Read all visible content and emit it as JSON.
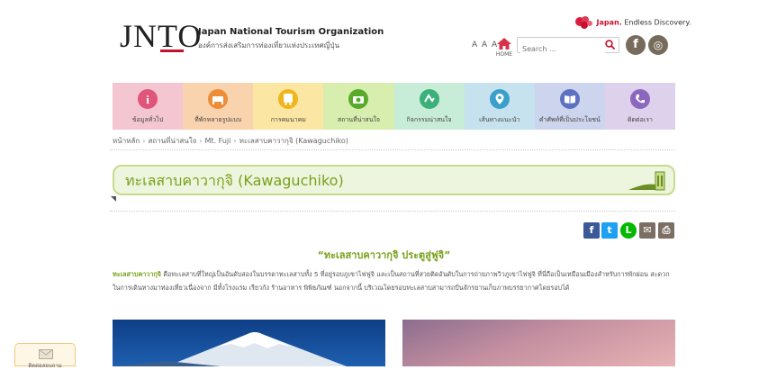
{
  "header": {
    "logo": "JNTO",
    "org_name_en": "Japan National Tourism Organization",
    "org_name_th": "องค์การส่งเสริมการท่องเที่ยวแห่งประเทศญี่ปุ่น",
    "tagline_brand": "Japan.",
    "tagline_rest": " Endless Discovery.",
    "font_size_control": "A A A",
    "home_label": "HOME",
    "search_placeholder": "Search ...",
    "social": [
      {
        "icon": "facebook-icon",
        "glyph": "f"
      },
      {
        "icon": "instagram-icon",
        "glyph": "◎"
      }
    ]
  },
  "nav": [
    {
      "label": "ข้อมูลทั่วไป",
      "icon": "info-icon",
      "bg": "#f4c6d2",
      "icon_color": "#e0557a"
    },
    {
      "label": "ที่พักหลายรูปแบบ",
      "icon": "bed-icon",
      "bg": "#f9d3ae",
      "icon_color": "#ee8d37"
    },
    {
      "label": "การคมนาคม",
      "icon": "bus-icon",
      "bg": "#fbe7a3",
      "icon_color": "#f0b51b"
    },
    {
      "label": "สถานที่น่าสนใจ",
      "icon": "camera-icon",
      "bg": "#d7eeae",
      "icon_color": "#58ab29"
    },
    {
      "label": "กิจกรรมน่าสนใจ",
      "icon": "activity-icon",
      "bg": "#c7ecd8",
      "icon_color": "#3bb07a"
    },
    {
      "label": "เส้นทางแนะนำ",
      "icon": "map-pin-icon",
      "bg": "#c5e2ee",
      "icon_color": "#3a9fca"
    },
    {
      "label": "คำศัพท์ที่เป็นประโยชน์",
      "icon": "book-icon",
      "bg": "#cdd5ee",
      "icon_color": "#5c72c0"
    },
    {
      "label": "ติดต่อเรา",
      "icon": "phone-icon",
      "bg": "#ddd1ec",
      "icon_color": "#8b67bf"
    }
  ],
  "breadcrumb": [
    "หน้าหลัก",
    "สถานที่น่าสนใจ",
    "Mt. Fuji",
    "ทะเลสาบคาวากุจิ (Kawaguchiko)"
  ],
  "page_title": "ทะเลสาบคาวากุจิ (Kawaguchiko)",
  "share_buttons": [
    {
      "icon": "facebook-share-icon",
      "glyph": "f",
      "color": "#3b5998"
    },
    {
      "icon": "twitter-share-icon",
      "glyph": "t",
      "color": "#1da1f2"
    },
    {
      "icon": "line-share-icon",
      "glyph": "L",
      "color": "#00b900"
    },
    {
      "icon": "email-share-icon",
      "glyph": "✉",
      "color": "#7b6f63"
    },
    {
      "icon": "print-icon",
      "glyph": "⎙",
      "color": "#7b6f63"
    }
  ],
  "sub_heading": "“ทะเลสาบคาวากุจิ ประตูสู่ฟูจิ”",
  "body": {
    "highlight": "ทะเลสาบคาวากุจิ",
    "text": " คือทะเลสาบที่ใหญ่เป็นอันดับสองในบรรดาทะเลสาบทั้ง 5 ที่อยู่รอบภูเขาไฟฟูจิ และเป็นสถานที่สวยติดอันดับในการถ่ายภาพวิวภูเขาไฟฟูจิ ที่นี่ถือเป็นเหมือนเมืองสำหรับการพักผ่อน สะดวกในการเดินทางมาท่องเที่ยวเนื่องจาก มีทั้งโรงแรม เรียวกัง ร้านอาหาร พิพิธภัณฑ์ นอกจากนี้ บริเวณโดยรอบทะเลสาบสามารถปั่นจักรยานเก็บภาพบรรยากาศโดยรอบได้"
  },
  "mail_widget": {
    "label": "ติดต่อสอบถาม"
  }
}
